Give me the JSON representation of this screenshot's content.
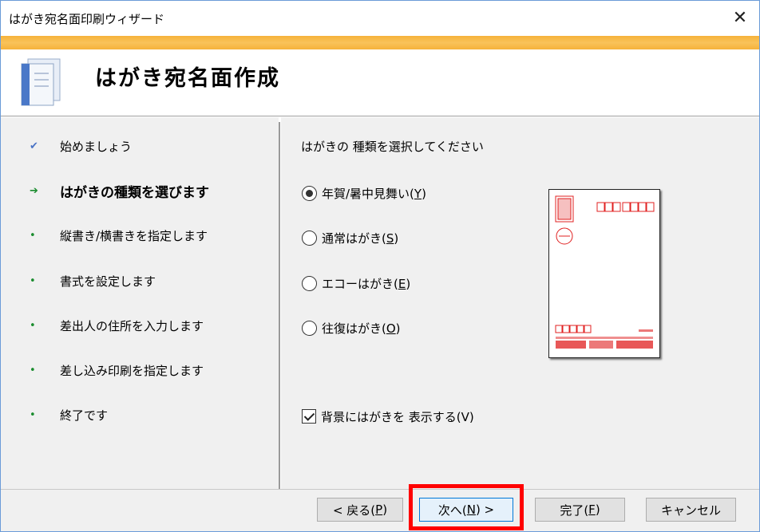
{
  "window": {
    "title": "はがき宛名面印刷ウィザード",
    "close_symbol": "✕"
  },
  "header": {
    "heading": "はがき宛名面作成"
  },
  "steps": [
    {
      "mark": "✔",
      "label": "始めましょう",
      "state": "done"
    },
    {
      "mark": "➔",
      "label": "はがきの種類を選びます",
      "state": "current"
    },
    {
      "mark": "•",
      "label": "縦書き/横書きを指定します",
      "state": "todo"
    },
    {
      "mark": "•",
      "label": "書式を設定します",
      "state": "todo"
    },
    {
      "mark": "•",
      "label": "差出人の住所を入力します",
      "state": "todo"
    },
    {
      "mark": "•",
      "label": "差し込み印刷を指定します",
      "state": "todo"
    },
    {
      "mark": "•",
      "label": "終了です",
      "state": "todo"
    }
  ],
  "main": {
    "prompt": "はがきの 種類を選択してください",
    "options": [
      {
        "label": "年賀/暑中見舞い(",
        "key": "Y",
        "tail": ")",
        "checked": true
      },
      {
        "label": "通常はがき(",
        "key": "S",
        "tail": ")",
        "checked": false
      },
      {
        "label": "エコーはがき(",
        "key": "E",
        "tail": ")",
        "checked": false
      },
      {
        "label": "往復はがき(",
        "key": "O",
        "tail": ")",
        "checked": false
      }
    ],
    "show_background": {
      "label": "背景にはがきを 表示する(V)",
      "checked": true
    }
  },
  "footer": {
    "back": {
      "label": "< 戻る(",
      "key": "P",
      "tail": ")"
    },
    "next": {
      "label": "次へ(",
      "key": "N",
      "tail": ") >"
    },
    "finish": {
      "label": "完了(",
      "key": "F",
      "tail": ")"
    },
    "cancel": {
      "label": "キャンセル"
    }
  },
  "colors": {
    "accent_bar": "#f6b23a",
    "highlight_box": "#ff0000",
    "stamp_red": "#e02020"
  }
}
